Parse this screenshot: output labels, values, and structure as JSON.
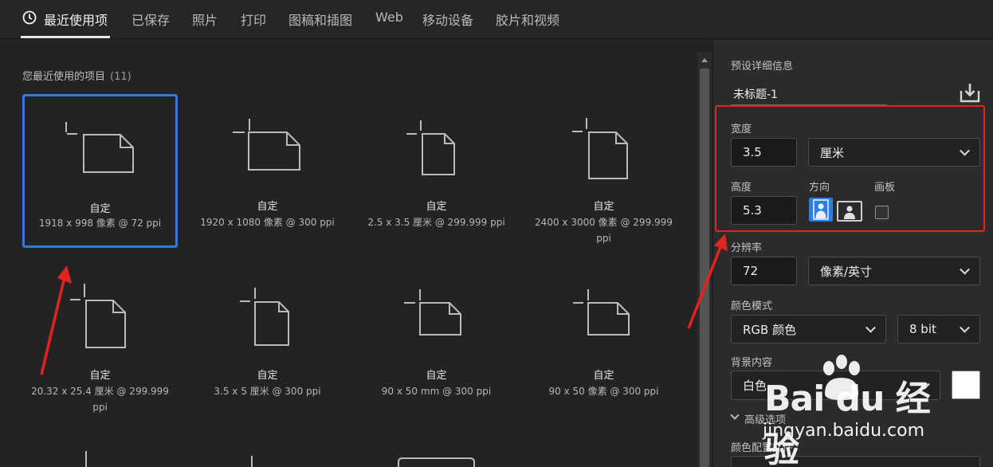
{
  "tabs": [
    {
      "label": "最近使用项",
      "active": true
    },
    {
      "label": "已保存"
    },
    {
      "label": "照片"
    },
    {
      "label": "打印"
    },
    {
      "label": "图稿和插图"
    },
    {
      "label": "Web"
    },
    {
      "label": "移动设备"
    },
    {
      "label": "胶片和视频"
    }
  ],
  "recent": {
    "title": "您最近使用的项目",
    "count": "(11)",
    "items": [
      {
        "name": "自定",
        "dims": "1918 x 998 像素 @ 72 ppi",
        "selected": true
      },
      {
        "name": "自定",
        "dims": "1920 x 1080 像素 @ 300 ppi"
      },
      {
        "name": "自定",
        "dims": "2.5 x 3.5 厘米 @ 299.999 ppi"
      },
      {
        "name": "自定",
        "dims_line1": "2400 x 3000 像素 @ 299.999",
        "dims_line2": "ppi"
      },
      {
        "name": "自定",
        "dims_line1": "20.32 x 25.4 厘米 @ 299.999",
        "dims_line2": "ppi"
      },
      {
        "name": "自定",
        "dims": "3.5 x 5 厘米 @ 300 ppi"
      },
      {
        "name": "自定",
        "dims": "90 x 50 mm @ 300 ppi"
      },
      {
        "name": "自定",
        "dims": "90 x 50 像素 @ 300 ppi"
      }
    ]
  },
  "preset": {
    "header": "预设详细信息",
    "doc_name": "未标题-1",
    "width_label": "宽度",
    "width_value": "3.5",
    "width_unit": "厘米",
    "height_label": "高度",
    "height_value": "5.3",
    "orientation_label": "方向",
    "artboard_label": "画板",
    "resolution_label": "分辨率",
    "resolution_value": "72",
    "resolution_unit": "像素/英寸",
    "color_mode_label": "颜色模式",
    "color_mode_value": "RGB 颜色",
    "bit_depth_value": "8 bit",
    "background_label": "背景内容",
    "background_value": "白色",
    "advanced_label": "高级选项",
    "color_profile_label": "颜色配置文件"
  },
  "watermark": {
    "main": "Bai du 经验",
    "sub": "jingyan.baidu.com"
  },
  "colors": {
    "selection": "#2f7bd6",
    "annotation": "#e3231f",
    "orientation_active": "#2e7de0"
  }
}
